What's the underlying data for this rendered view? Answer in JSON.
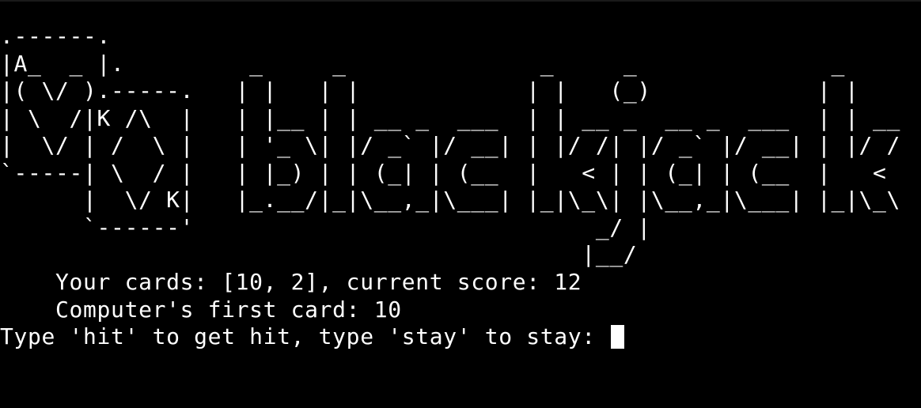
{
  "terminal": {
    "background": "#000000",
    "foreground": "#ffffff",
    "ascii_art": [
      ".------.                                                      ",
      "|A_  _ |.         _     _              _     _              _",
      "|( \\/ ).-----.   | |   | |            | |   (_)            | |",
      "| \\  /|K /\\  |   | |__ | | __ _  ___  | | __ _  __ _  ___  | | __",
      "|  \\/ | /  \\ |   | '_ \\| |/ _` |/ __| | |/ /| |/ _` |/ __| | |/ /",
      "`-----| \\  / |   | |_) | | (_| | (__  |   < | | (_| | (__  |   <",
      "      |  \\/ K|   |_.__/|_|\\__,_|\\___| |_|\\_\\| |\\__,_|\\___| |_|\\_\\",
      "      `------'                             _/ |",
      "                                          |__/"
    ],
    "status_lines": [
      "    Your cards: [10, 2], current score: 12",
      "    Computer's first card: 10"
    ],
    "prompt": "Type 'hit' to get hit, type 'stay' to stay: "
  }
}
